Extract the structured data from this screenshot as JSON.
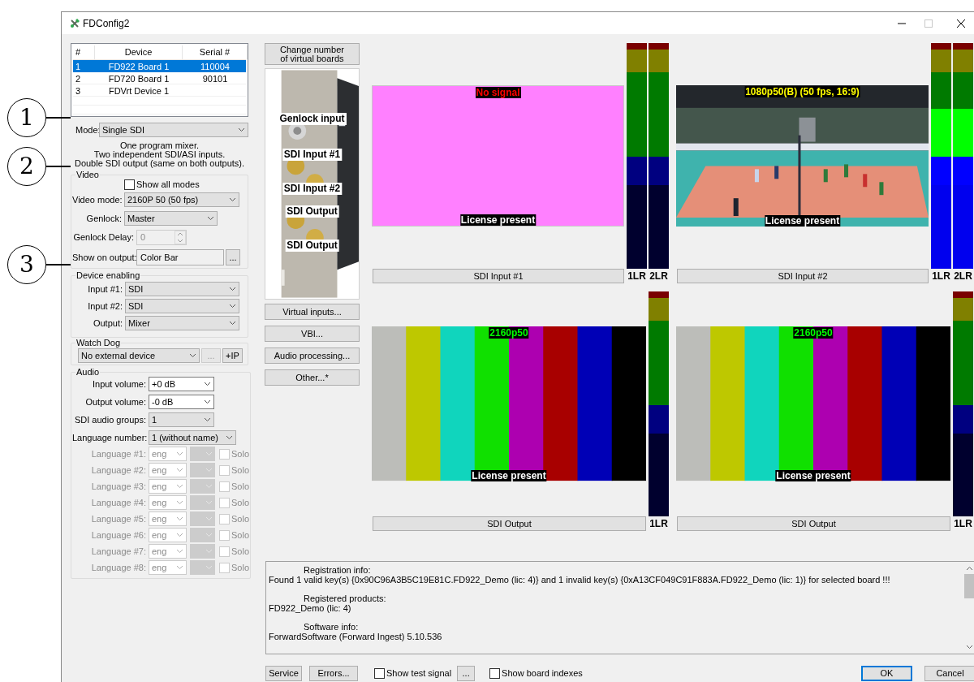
{
  "window": {
    "title": "FDConfig2"
  },
  "callouts": [
    {
      "number": "1"
    },
    {
      "number": "2"
    },
    {
      "number": "3"
    }
  ],
  "device_table": {
    "columns": [
      "#",
      "Device",
      "Serial #"
    ],
    "rows": [
      {
        "index": "1",
        "device": "FD922 Board 1",
        "serial": "110004",
        "selected": true
      },
      {
        "index": "2",
        "device": "FD720 Board 1",
        "serial": "90101",
        "selected": false
      },
      {
        "index": "3",
        "device": "FDVrt Device 1",
        "selected": false
      }
    ]
  },
  "mode": {
    "label": "Mode:",
    "value": "Single SDI"
  },
  "mode_description": [
    "One program mixer.",
    "Two independent SDI/ASI inputs.",
    "Double SDI output (same on both outputs)."
  ],
  "video": {
    "title": "Video",
    "show_all_modes": {
      "label": "Show all modes",
      "checked": false
    },
    "fields": [
      {
        "kind": "select",
        "label": "Video mode:",
        "value": "2160P 50 (50 fps)"
      },
      {
        "kind": "select",
        "label": "Genlock:",
        "value": "Master"
      },
      {
        "kind": "spinner",
        "label": "Genlock Delay:",
        "value": "0",
        "disabled": true
      },
      {
        "kind": "browse",
        "label": "Show on output:",
        "value": "Color Bar",
        "button": "..."
      }
    ]
  },
  "device_enabling": {
    "title": "Device enabling",
    "fields": [
      {
        "label": "Input #1:",
        "value": "SDI"
      },
      {
        "label": "Input #2:",
        "value": "SDI"
      },
      {
        "label": "Output:",
        "value": "Mixer"
      }
    ]
  },
  "watch_dog": {
    "title": "Watch Dog",
    "value": "No external device",
    "browse_button": {
      "label": "...",
      "disabled": true
    },
    "ip_button": "+IP"
  },
  "audio": {
    "title": "Audio",
    "fields": [
      {
        "kind": "editable",
        "label": "Input volume:",
        "value": "+0 dB"
      },
      {
        "kind": "editable",
        "label": "Output volume:",
        "value": "-0 dB"
      },
      {
        "kind": "select",
        "label": "SDI audio groups:",
        "value": "1"
      },
      {
        "kind": "select",
        "label": "Language number:",
        "value": "1 (without name)"
      }
    ],
    "languages": [
      {
        "label": "Language #1:",
        "value": "eng",
        "solo": "Solo",
        "solo_checked": false,
        "disabled": true
      },
      {
        "label": "Language #2:",
        "value": "eng",
        "solo": "Solo",
        "solo_checked": false,
        "disabled": true
      },
      {
        "label": "Language #3:",
        "value": "eng",
        "solo": "Solo",
        "solo_checked": false,
        "disabled": true
      },
      {
        "label": "Language #4:",
        "value": "eng",
        "solo": "Solo",
        "solo_checked": false,
        "disabled": true
      },
      {
        "label": "Language #5:",
        "value": "eng",
        "solo": "Solo",
        "solo_checked": false,
        "disabled": true
      },
      {
        "label": "Language #6:",
        "value": "eng",
        "solo": "Solo",
        "solo_checked": false,
        "disabled": true
      },
      {
        "label": "Language #7:",
        "value": "eng",
        "solo": "Solo",
        "solo_checked": false,
        "disabled": true
      },
      {
        "label": "Language #8:",
        "value": "eng",
        "solo": "Solo",
        "solo_checked": false,
        "disabled": true
      }
    ]
  },
  "change_boards_button": "Change number\nof virtual boards",
  "board_picture": {
    "labels": [
      "Genlock input",
      "SDI Input #1",
      "SDI Input #2",
      "SDI Output",
      "SDI Output"
    ]
  },
  "side_buttons": [
    "Virtual inputs...",
    "VBI...",
    "Audio processing...",
    "Other...*"
  ],
  "previews": [
    {
      "kind": "no_signal",
      "top_label": {
        "text": "No signal",
        "kind": "error"
      },
      "bottom_label": "License present",
      "caption": "SDI Input #1",
      "meter": [
        {
          "label": "1LR",
          "level": 0
        },
        {
          "label": "2LR",
          "level": 0
        }
      ]
    },
    {
      "kind": "picture",
      "top_label": {
        "text": "1080p50(B) (50 fps, 16:9)",
        "kind": "input_format"
      },
      "bottom_label": "License present",
      "caption": "SDI Input #2",
      "meter": [
        {
          "label": "1LR",
          "level": 0.71
        },
        {
          "label": "2LR",
          "level": 0.71
        }
      ]
    },
    {
      "kind": "color_bars",
      "top_label": {
        "text": "2160p50",
        "kind": "output_format"
      },
      "bottom_label": "License present",
      "caption": "SDI Output",
      "meter": [
        {
          "label": "1LR",
          "level": 0
        }
      ]
    },
    {
      "kind": "color_bars",
      "top_label": {
        "text": "2160p50",
        "kind": "output_format"
      },
      "bottom_label": "License present",
      "caption": "SDI Output",
      "meter": [
        {
          "label": "1LR",
          "level": 0
        }
      ]
    }
  ],
  "log": [
    {
      "kind": "heading",
      "text": "Registration info:"
    },
    {
      "kind": "body",
      "text": "Found 1 valid key(s) {0x90C96A3B5C19E81C.FD922_Demo (lic: 4)} and 1 invalid key(s) {0xA13CF049C91F883A.FD922_Demo (lic: 1)} for selected board !!!"
    },
    {
      "kind": "heading",
      "text": "Registered products:"
    },
    {
      "kind": "body",
      "text": "FD922_Demo (lic: 4)"
    },
    {
      "kind": "heading",
      "text": "Software info:"
    },
    {
      "kind": "body",
      "text": "ForwardSoftware (Forward Ingest) 5.10.536"
    }
  ],
  "footer": {
    "service": "Service",
    "errors": "Errors...",
    "show_test_signal": {
      "label": "Show test signal",
      "checked": false
    },
    "more": "...",
    "show_board_indexes": {
      "label": "Show board indexes",
      "checked": false
    },
    "ok": "OK",
    "cancel": "Cancel"
  }
}
